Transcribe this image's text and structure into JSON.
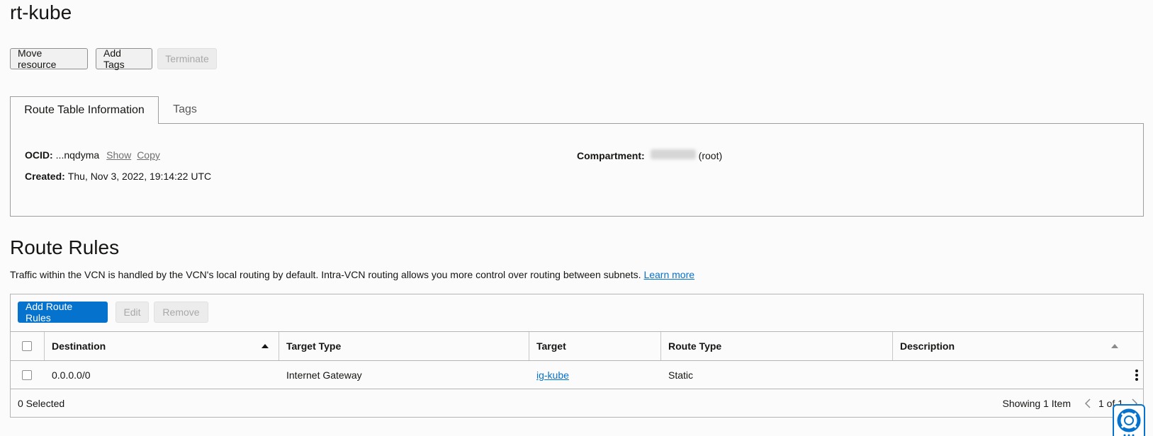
{
  "page": {
    "title": "rt-kube"
  },
  "actions": {
    "move_resource": "Move resource",
    "add_tags": "Add Tags",
    "terminate": "Terminate"
  },
  "tabs": [
    {
      "label": "Route Table Information",
      "active": true
    },
    {
      "label": "Tags",
      "active": false
    }
  ],
  "info": {
    "ocid_label": "OCID:",
    "ocid_value": "...nqdyma",
    "show_link": "Show",
    "copy_link": "Copy",
    "created_label": "Created:",
    "created_value": "Thu, Nov 3, 2022, 19:14:22 UTC",
    "compartment_label": "Compartment:",
    "compartment_suffix": "(root)"
  },
  "route_rules": {
    "heading": "Route Rules",
    "description": "Traffic within the VCN is handled by the VCN's local routing by default. Intra-VCN routing allows you more control over routing between subnets.",
    "learn_more": "Learn more",
    "toolbar": {
      "add": "Add Route Rules",
      "edit": "Edit",
      "remove": "Remove"
    },
    "columns": [
      "Destination",
      "Target Type",
      "Target",
      "Route Type",
      "Description"
    ],
    "rows": [
      {
        "destination": "0.0.0.0/0",
        "target_type": "Internet Gateway",
        "target": "ig-kube",
        "route_type": "Static",
        "description": ""
      }
    ],
    "footer": {
      "selected": "0 Selected",
      "showing": "Showing 1 Item",
      "page": "1 of 1"
    }
  },
  "colors": {
    "primary": "#0572ce",
    "link": "#0572ce"
  },
  "icons": [
    "sort-ascending-icon",
    "kebab-menu-icon",
    "chevron-left-icon",
    "chevron-right-icon",
    "help-lifebuoy-icon"
  ]
}
